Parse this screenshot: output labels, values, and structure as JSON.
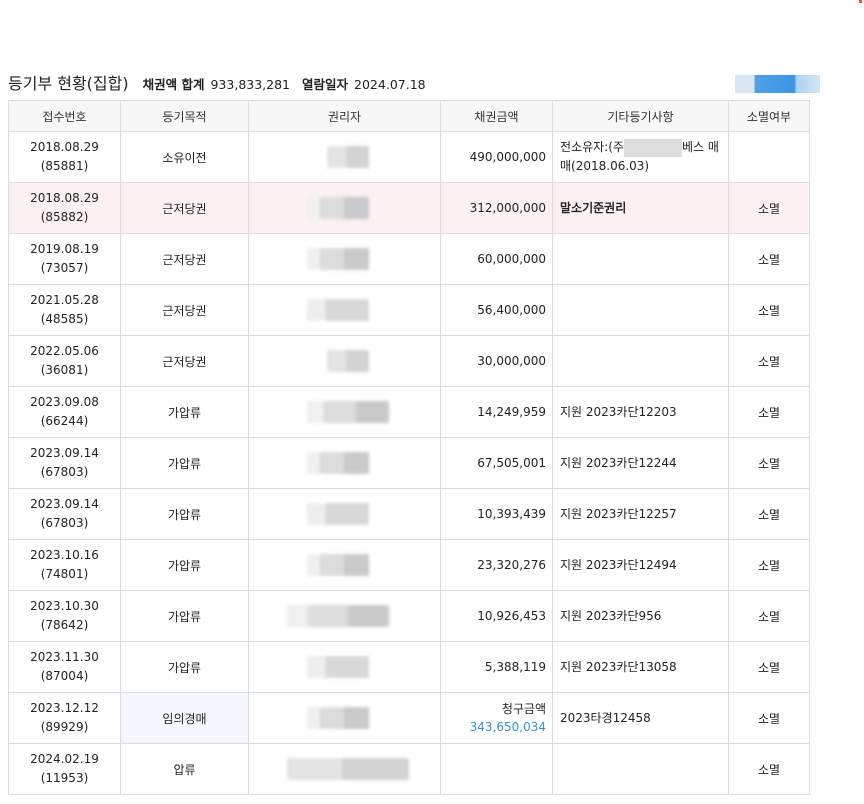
{
  "header": {
    "title": "등기부 현황(집합)",
    "sum_label": "채권액 합계",
    "sum_value": "933,833,281",
    "date_label": "열람일자",
    "date_value": "2024.07.18"
  },
  "table": {
    "columns": [
      "접수번호",
      "등기목적",
      "권리자",
      "채권금액",
      "기타등기사항",
      "소멸여부"
    ],
    "rows": [
      {
        "date": "2018.08.29",
        "number": "(85881)",
        "purpose": "소유이전",
        "amount": "490,000,000",
        "notes_pre": "전소유자:(주",
        "notes_post": "베스 매매(2018.06.03)",
        "extinct": ""
      },
      {
        "date": "2018.08.29",
        "number": "(85882)",
        "purpose": "근저당권",
        "amount": "312,000,000",
        "notes": "말소기준권리",
        "extinct": "소멸"
      },
      {
        "date": "2019.08.19",
        "number": "(73057)",
        "purpose": "근저당권",
        "amount": "60,000,000",
        "notes": "",
        "extinct": "소멸"
      },
      {
        "date": "2021.05.28",
        "number": "(48585)",
        "purpose": "근저당권",
        "amount": "56,400,000",
        "notes": "",
        "extinct": "소멸"
      },
      {
        "date": "2022.05.06",
        "number": "(36081)",
        "purpose": "근저당권",
        "amount": "30,000,000",
        "notes": "",
        "extinct": "소멸"
      },
      {
        "date": "2023.09.08",
        "number": "(66244)",
        "purpose": "가압류",
        "amount": "14,249,959",
        "notes": "지원 2023카단12203",
        "extinct": "소멸"
      },
      {
        "date": "2023.09.14",
        "number": "(67803)",
        "purpose": "가압류",
        "amount": "67,505,001",
        "notes": "지원 2023카단12244",
        "extinct": "소멸"
      },
      {
        "date": "2023.09.14",
        "number": "(67803)",
        "purpose": "가압류",
        "amount": "10,393,439",
        "notes": "지원 2023카단12257",
        "extinct": "소멸"
      },
      {
        "date": "2023.10.16",
        "number": "(74801)",
        "purpose": "가압류",
        "amount": "23,320,276",
        "notes": "지원 2023카단12494",
        "extinct": "소멸"
      },
      {
        "date": "2023.10.30",
        "number": "(78642)",
        "purpose": "가압류",
        "amount": "10,926,453",
        "notes": "지원 2023카단956",
        "extinct": "소멸"
      },
      {
        "date": "2023.11.30",
        "number": "(87004)",
        "purpose": "가압류",
        "amount": "5,388,119",
        "notes": "지원 2023카단13058",
        "extinct": "소멸"
      },
      {
        "date": "2023.12.12",
        "number": "(89929)",
        "purpose": "임의경매",
        "claim_label": "청구금액",
        "claim_value": "343,650,034",
        "notes": "2023타경12458",
        "extinct": "소멸"
      },
      {
        "date": "2024.02.19",
        "number": "(11953)",
        "purpose": "압류",
        "amount": "",
        "notes": "",
        "extinct": "소멸"
      }
    ]
  },
  "colors": {
    "highlight_row": "#fdf0f0",
    "link_blue": "#3d8fd8",
    "header_bg": "#f7f7f7",
    "border": "#dcdcdc"
  }
}
